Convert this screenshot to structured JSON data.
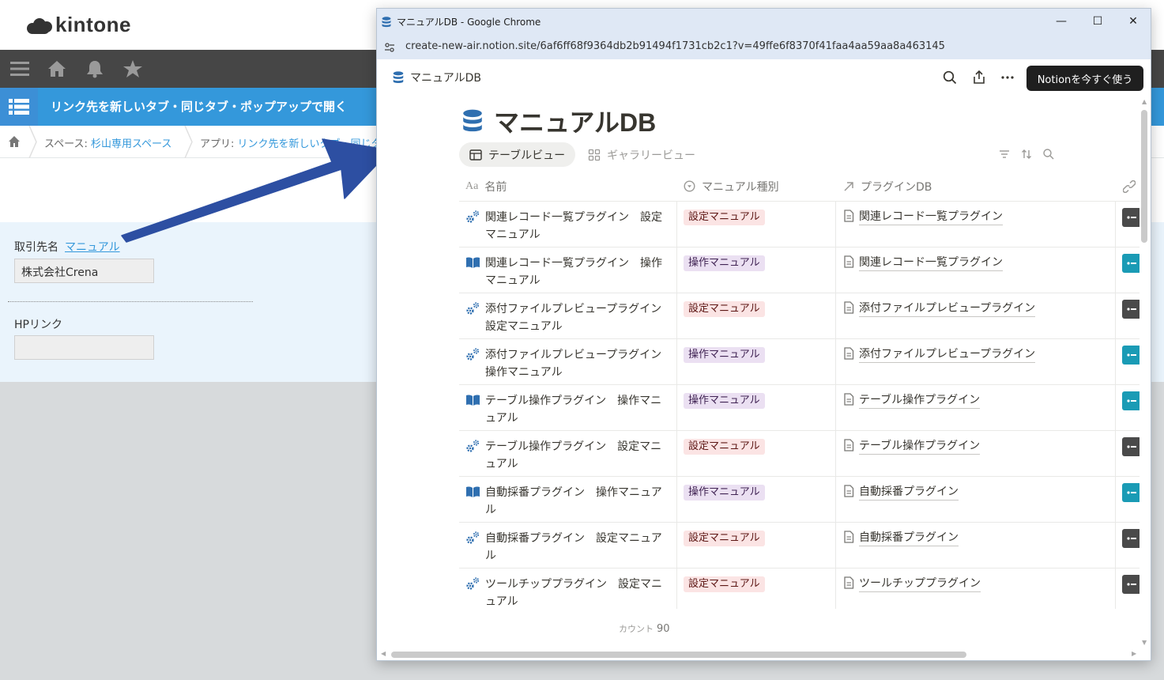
{
  "kintone": {
    "logo_text": "kintone",
    "app_title": "リンク先を新しいタブ・同じタブ・ポップアップで開く",
    "breadcrumb": {
      "space_prefix": "スペース: ",
      "space_name": "杉山専用スペース",
      "app_prefix": "アプリ: ",
      "app_name": "リンク先を新しいタブ・同じタブ"
    },
    "form": {
      "field1_label": "取引先名",
      "field1_link": "マニュアル",
      "field1_value": "株式会社Crena",
      "field2_label": "HPリンク",
      "field2_value": ""
    }
  },
  "browser": {
    "window_title": "マニュアルDB - Google Chrome",
    "url": "create-new-air.notion.site/6af6ff68f9364db2b91494f1731cb2c1?v=49ffe6f8370f41faa4aa59aa8a463145",
    "controls": {
      "minimize": "—",
      "maximize": "☐",
      "close": "✕"
    }
  },
  "notion": {
    "breadcrumb": "マニュアルDB",
    "cta_button": "Notionを今すぐ使う",
    "page_title": "マニュアルDB",
    "tabs": [
      {
        "label": "テーブルビュー",
        "active": true
      },
      {
        "label": "ギャラリービュー",
        "active": false
      }
    ],
    "columns": {
      "name": "名前",
      "name_icon": "Aa",
      "type": "マニュアル種別",
      "plugin": "プラグインDB"
    },
    "rows": [
      {
        "name": "関連レコード一覧プラグイン　設定マニュアル",
        "icon": "gears-icon",
        "type": "設定マニュアル",
        "kind": "set",
        "plugin": "関連レコード一覧プラグイン"
      },
      {
        "name": "関連レコード一覧プラグイン　操作マニュアル",
        "icon": "book-icon",
        "type": "操作マニュアル",
        "kind": "op",
        "plugin": "関連レコード一覧プラグイン"
      },
      {
        "name": "添付ファイルプレビュープラグイン設定マニュアル",
        "icon": "gears-icon",
        "type": "設定マニュアル",
        "kind": "set",
        "plugin": "添付ファイルプレビュープラグイン"
      },
      {
        "name": "添付ファイルプレビュープラグイン操作マニュアル",
        "icon": "gears-icon",
        "type": "操作マニュアル",
        "kind": "op",
        "plugin": "添付ファイルプレビュープラグイン"
      },
      {
        "name": "テーブル操作プラグイン　操作マニュアル",
        "icon": "book-icon",
        "type": "操作マニュアル",
        "kind": "op",
        "plugin": "テーブル操作プラグイン"
      },
      {
        "name": "テーブル操作プラグイン　設定マニュアル",
        "icon": "gears-icon",
        "type": "設定マニュアル",
        "kind": "set",
        "plugin": "テーブル操作プラグイン"
      },
      {
        "name": "自動採番プラグイン　操作マニュアル",
        "icon": "book-icon",
        "type": "操作マニュアル",
        "kind": "op",
        "plugin": "自動採番プラグイン"
      },
      {
        "name": "自動採番プラグイン　設定マニュアル",
        "icon": "gears-icon",
        "type": "設定マニュアル",
        "kind": "set",
        "plugin": "自動採番プラグイン"
      },
      {
        "name": "ツールチッププラグイン　設定マニュアル",
        "icon": "gears-icon",
        "type": "設定マニュアル",
        "kind": "set",
        "plugin": "ツールチッププラグイン"
      }
    ],
    "count_label": "カウント",
    "count_value": "90",
    "colors": {
      "set_tag_bg": "#fbe4e4",
      "op_tag_bg": "#ebe0f2",
      "accent_blue": "#3498db",
      "icon_blue": "#2f6fb0"
    }
  }
}
